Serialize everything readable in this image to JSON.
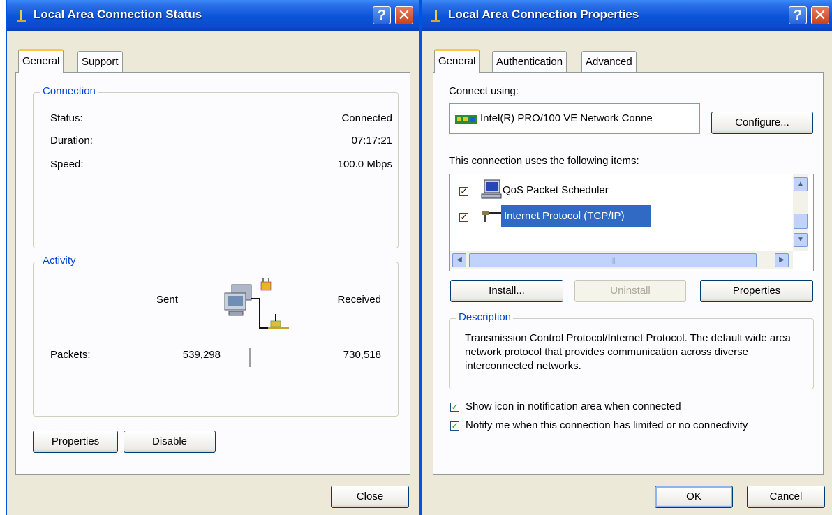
{
  "status_window": {
    "title": "Local Area Connection Status",
    "tabs": [
      "General",
      "Support"
    ],
    "connection": {
      "legend": "Connection",
      "status_label": "Status:",
      "status_value": "Connected",
      "duration_label": "Duration:",
      "duration_value": "07:17:21",
      "speed_label": "Speed:",
      "speed_value": "100.0 Mbps"
    },
    "activity": {
      "legend": "Activity",
      "sent_label": "Sent",
      "received_label": "Received",
      "packets_label": "Packets:",
      "packets_sent": "539,298",
      "packets_received": "730,518"
    },
    "buttons": {
      "properties": "Properties",
      "disable": "Disable",
      "close": "Close"
    }
  },
  "properties_window": {
    "title": "Local Area Connection Properties",
    "tabs": [
      "General",
      "Authentication",
      "Advanced"
    ],
    "connect_using_label": "Connect using:",
    "adapter_name": "Intel(R) PRO/100 VE Network Conne",
    "configure_button": "Configure...",
    "items_label": "This connection uses the following items:",
    "items": [
      {
        "label": "QoS Packet Scheduler",
        "checked": true,
        "selected": false
      },
      {
        "label": "Internet Protocol (TCP/IP)",
        "checked": true,
        "selected": true
      }
    ],
    "buttons": {
      "install": "Install...",
      "uninstall": "Uninstall",
      "properties": "Properties",
      "ok": "OK",
      "cancel": "Cancel"
    },
    "description": {
      "legend": "Description",
      "text": "Transmission Control Protocol/Internet Protocol. The default wide area network protocol that provides communication across diverse interconnected networks."
    },
    "options": [
      {
        "label": "Show icon in notification area when connected",
        "checked": true
      },
      {
        "label": "Notify me when this connection has limited or no connectivity",
        "checked": true
      }
    ]
  },
  "colors": {
    "title_bar": "#0a54d9",
    "selection": "#316ac5",
    "group_legend": "#0046d5",
    "dialog_bg": "#ece9d8"
  }
}
